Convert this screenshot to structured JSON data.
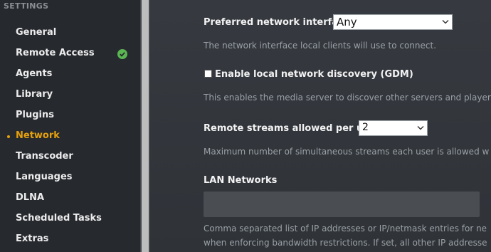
{
  "sidebar": {
    "header": "SETTINGS",
    "items": [
      {
        "label": "General"
      },
      {
        "label": "Remote Access"
      },
      {
        "label": "Agents"
      },
      {
        "label": "Library"
      },
      {
        "label": "Plugins"
      },
      {
        "label": "Network"
      },
      {
        "label": "Transcoder"
      },
      {
        "label": "Languages"
      },
      {
        "label": "DLNA"
      },
      {
        "label": "Scheduled Tasks"
      },
      {
        "label": "Extras"
      }
    ],
    "active_item": "Network",
    "remote_access_status_icon": "check-circle-icon"
  },
  "network": {
    "preferred_interface": {
      "label": "Preferred network interface",
      "value": "Any",
      "help": "The network interface local clients will use to connect."
    },
    "local_discovery": {
      "label": "Enable local network discovery (GDM)",
      "checked": false,
      "help": "This enables the media server to discover other servers and player"
    },
    "remote_streams": {
      "label": "Remote streams allowed per user",
      "value": "2",
      "help": "Maximum number of simultaneous streams each user is allowed w"
    },
    "lan_networks": {
      "label": "LAN Networks",
      "value": "",
      "help_line1": "Comma separated list of IP addresses or IP/netmask entries for ne",
      "help_line2": "when enforcing bandwidth restrictions. If set, all other IP addresse"
    }
  },
  "colors": {
    "accent": "#e5a00d",
    "status_ok": "#5ab552"
  }
}
